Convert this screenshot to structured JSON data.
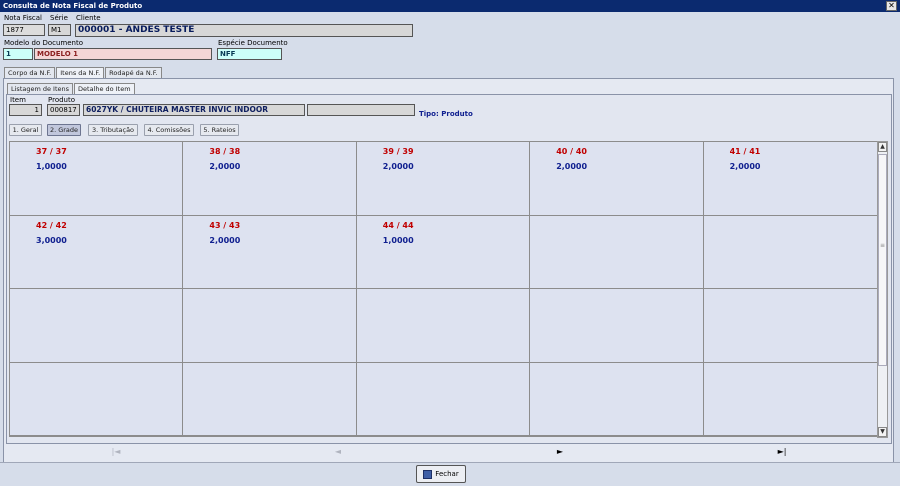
{
  "window": {
    "title": "Consulta de Nota Fiscal de Produto"
  },
  "header": {
    "nota_fiscal_label": "Nota Fiscal",
    "nota_fiscal_value": "1877",
    "serie_label": "Série",
    "serie_value": "M1",
    "cliente_label": "Cliente",
    "cliente_value": "000001 - ANDES TESTE",
    "modelo_label": "Modelo do Documento",
    "modelo_code": "1",
    "modelo_value": "MODELO 1",
    "especie_label": "Espécie Documento",
    "especie_value": "NFF"
  },
  "main_tabs": [
    "Corpo da N.F.",
    "Itens da N.F.",
    "Rodapé da N.F."
  ],
  "sub_tabs": [
    "Listagem de Itens",
    "Detalhe do Item"
  ],
  "item": {
    "item_label": "Item",
    "item_value": "1",
    "produto_label": "Produto",
    "produto_code": "000817",
    "produto_desc": "6027YK / CHUTEIRA MASTER INVIC INDOOR",
    "extra_value": "",
    "tipo_text": "Tipo: Produto"
  },
  "detail_buttons": [
    "1. Geral",
    "2. Grade",
    "3. Tributação",
    "4. Comissões",
    "5. Rateios"
  ],
  "grade_cells": [
    {
      "size": "37 / 37",
      "qty": "1,0000"
    },
    {
      "size": "38 / 38",
      "qty": "2,0000"
    },
    {
      "size": "39 / 39",
      "qty": "2,0000"
    },
    {
      "size": "40 / 40",
      "qty": "2,0000"
    },
    {
      "size": "41 / 41",
      "qty": "2,0000"
    },
    {
      "size": "42 / 42",
      "qty": "3,0000"
    },
    {
      "size": "43 / 43",
      "qty": "2,0000"
    },
    {
      "size": "44 / 44",
      "qty": "1,0000"
    },
    {
      "size": "",
      "qty": ""
    },
    {
      "size": "",
      "qty": ""
    },
    {
      "size": "",
      "qty": ""
    },
    {
      "size": "",
      "qty": ""
    },
    {
      "size": "",
      "qty": ""
    },
    {
      "size": "",
      "qty": ""
    },
    {
      "size": "",
      "qty": ""
    },
    {
      "size": "",
      "qty": ""
    },
    {
      "size": "",
      "qty": ""
    },
    {
      "size": "",
      "qty": ""
    },
    {
      "size": "",
      "qty": ""
    },
    {
      "size": "",
      "qty": ""
    }
  ],
  "navigation": {
    "first": "|◄",
    "prev": "◄",
    "next": "►",
    "last": "►|"
  },
  "footer": {
    "fechar_label": "Fechar"
  },
  "icons": {
    "close": "close-icon",
    "fechar": "door-icon",
    "scroll_up": "arrow-up-icon",
    "scroll_down": "arrow-down-icon"
  },
  "colors": {
    "title_bar": "#0b2a6f",
    "size_text": "#c00000",
    "qty_text": "#102090"
  }
}
